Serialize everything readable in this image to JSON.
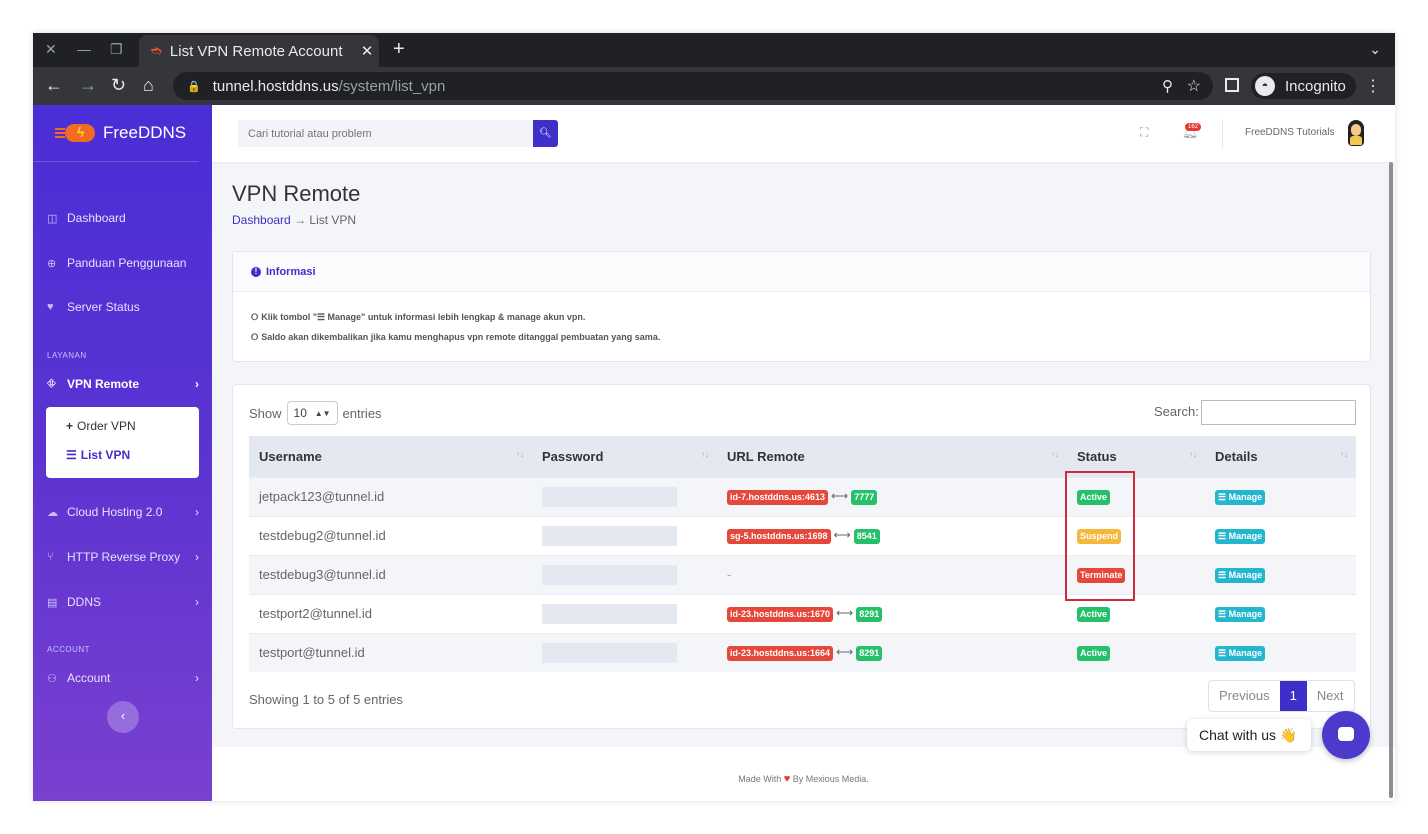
{
  "browser": {
    "tab_title": "List VPN Remote Account",
    "url_host": "tunnel.hostddns.us",
    "url_path": "/system/list_vpn",
    "profile_label": "Incognito"
  },
  "sidebar": {
    "brand": "FreeDDNS",
    "items": [
      {
        "label": "Dashboard",
        "icon": "layout-icon"
      },
      {
        "label": "Panduan Penggunaan",
        "icon": "globe-icon"
      },
      {
        "label": "Server Status",
        "icon": "heart-icon"
      }
    ],
    "section_layanan": "LAYANAN",
    "vpn_remote": "VPN Remote",
    "submenu": [
      {
        "label": "Order VPN",
        "icon": "plus-icon"
      },
      {
        "label": "List VPN",
        "icon": "list-icon"
      }
    ],
    "items2": [
      {
        "label": "Cloud Hosting 2.0",
        "icon": "cloud-icon"
      },
      {
        "label": "HTTP Reverse Proxy",
        "icon": "branch-icon"
      },
      {
        "label": "DDNS",
        "icon": "server-icon"
      }
    ],
    "section_account": "ACCOUNT",
    "account": "Account"
  },
  "topbar": {
    "search_placeholder": "Cari tutorial atau problem",
    "notification_count": "162",
    "user_name": "FreeDDNS Tutorials"
  },
  "page": {
    "title": "VPN Remote",
    "breadcrumb_home": "Dashboard",
    "breadcrumb_current": "List VPN"
  },
  "info": {
    "title": "Informasi",
    "line1": "Klik tombol \"☰ Manage\" untuk informasi lebih lengkap & manage akun vpn.",
    "line2": "Saldo akan dikembalikan jika kamu menghapus vpn remote ditanggal pembuatan yang sama."
  },
  "table": {
    "show_label": "Show",
    "entries_label": "entries",
    "page_length": "10",
    "search_label": "Search:",
    "columns": [
      "Username",
      "Password",
      "URL Remote",
      "Status",
      "Details"
    ],
    "rows": [
      {
        "username": "jetpack123@tunnel.id",
        "url": "id-7.hostddns.us:4613",
        "port": "7777",
        "status": "Active",
        "status_color": "#26c06b",
        "manage": "Manage"
      },
      {
        "username": "testdebug2@tunnel.id",
        "url": "sg-5.hostddns.us:1698",
        "port": "8541",
        "status": "Suspend",
        "status_color": "#f6b73c",
        "manage": "Manage"
      },
      {
        "username": "testdebug3@tunnel.id",
        "url": "",
        "port": "",
        "url_empty": "-",
        "status": "Terminate",
        "status_color": "#e5473a",
        "manage": "Manage"
      },
      {
        "username": "testport2@tunnel.id",
        "url": "id-23.hostddns.us:1670",
        "port": "8291",
        "status": "Active",
        "status_color": "#26c06b",
        "manage": "Manage"
      },
      {
        "username": "testport@tunnel.id",
        "url": "id-23.hostddns.us:1664",
        "port": "8291",
        "status": "Active",
        "status_color": "#26c06b",
        "manage": "Manage"
      }
    ],
    "info_text": "Showing 1 to 5 of 5 entries",
    "prev": "Previous",
    "current_page": "1",
    "next": "Next"
  },
  "footer": {
    "made_with": "Made With",
    "by": "By Mexious Media."
  },
  "chat": {
    "label": "Chat with us 👋"
  },
  "colors": {
    "primary": "#3f2fc9",
    "active": "#26c06b",
    "suspend": "#f6b73c",
    "terminate": "#e5473a",
    "manage": "#25b6cf",
    "url_badge": "#e5473a"
  }
}
